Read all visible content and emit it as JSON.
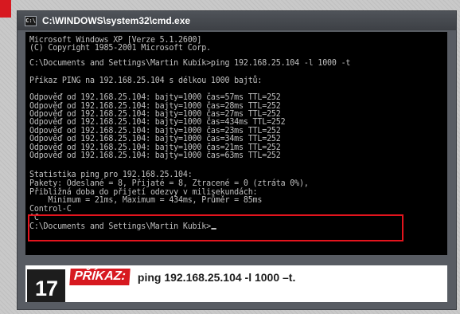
{
  "window": {
    "title": "C:\\WINDOWS\\system32\\cmd.exe",
    "icon_label": "C:\\",
    "icon": "cmd-icon"
  },
  "console": {
    "lines": [
      "Microsoft Windows XP [Verze 5.1.2600]",
      "(C) Copyright 1985-2001 Microsoft Corp.",
      "",
      "C:\\Documents and Settings\\Martin Kubík>ping 192.168.25.104 -l 1000 -t",
      "",
      "Příkaz PING na 192.168.25.104 s délkou 1000 bajtů:",
      "",
      "Odpověď od 192.168.25.104: bajty=1000 čas=57ms TTL=252",
      "Odpověď od 192.168.25.104: bajty=1000 čas=28ms TTL=252",
      "Odpověď od 192.168.25.104: bajty=1000 čas=27ms TTL=252",
      "Odpověď od 192.168.25.104: bajty=1000 čas=434ms TTL=252",
      "Odpověď od 192.168.25.104: bajty=1000 čas=23ms TTL=252",
      "Odpověď od 192.168.25.104: bajty=1000 čas=34ms TTL=252",
      "Odpověď od 192.168.25.104: bajty=1000 čas=21ms TTL=252",
      "Odpověď od 192.168.25.104: bajty=1000 čas=63ms TTL=252",
      "",
      "Statistika ping pro 192.168.25.104:",
      "Pakety: Odeslané = 8, Přijaté = 8, Ztracené = 0 (ztráta 0%),",
      "Přibližná doba do přijetí odezvy v milisekundách:",
      "    Minimum = 21ms, Maximum = 434ms, Průměr = 85ms",
      "Control-C",
      "^C",
      "C:\\Documents and Settings\\Martin Kubík>"
    ]
  },
  "caption": {
    "number": "17",
    "label": "PŘÍKAZ:",
    "command": "ping 192.168.25.104 -l 1000 –t."
  },
  "colors": {
    "accent": "#d71920",
    "console_bg": "#000000",
    "console_text": "#c0c0c0",
    "highlight": "#e3141d"
  }
}
